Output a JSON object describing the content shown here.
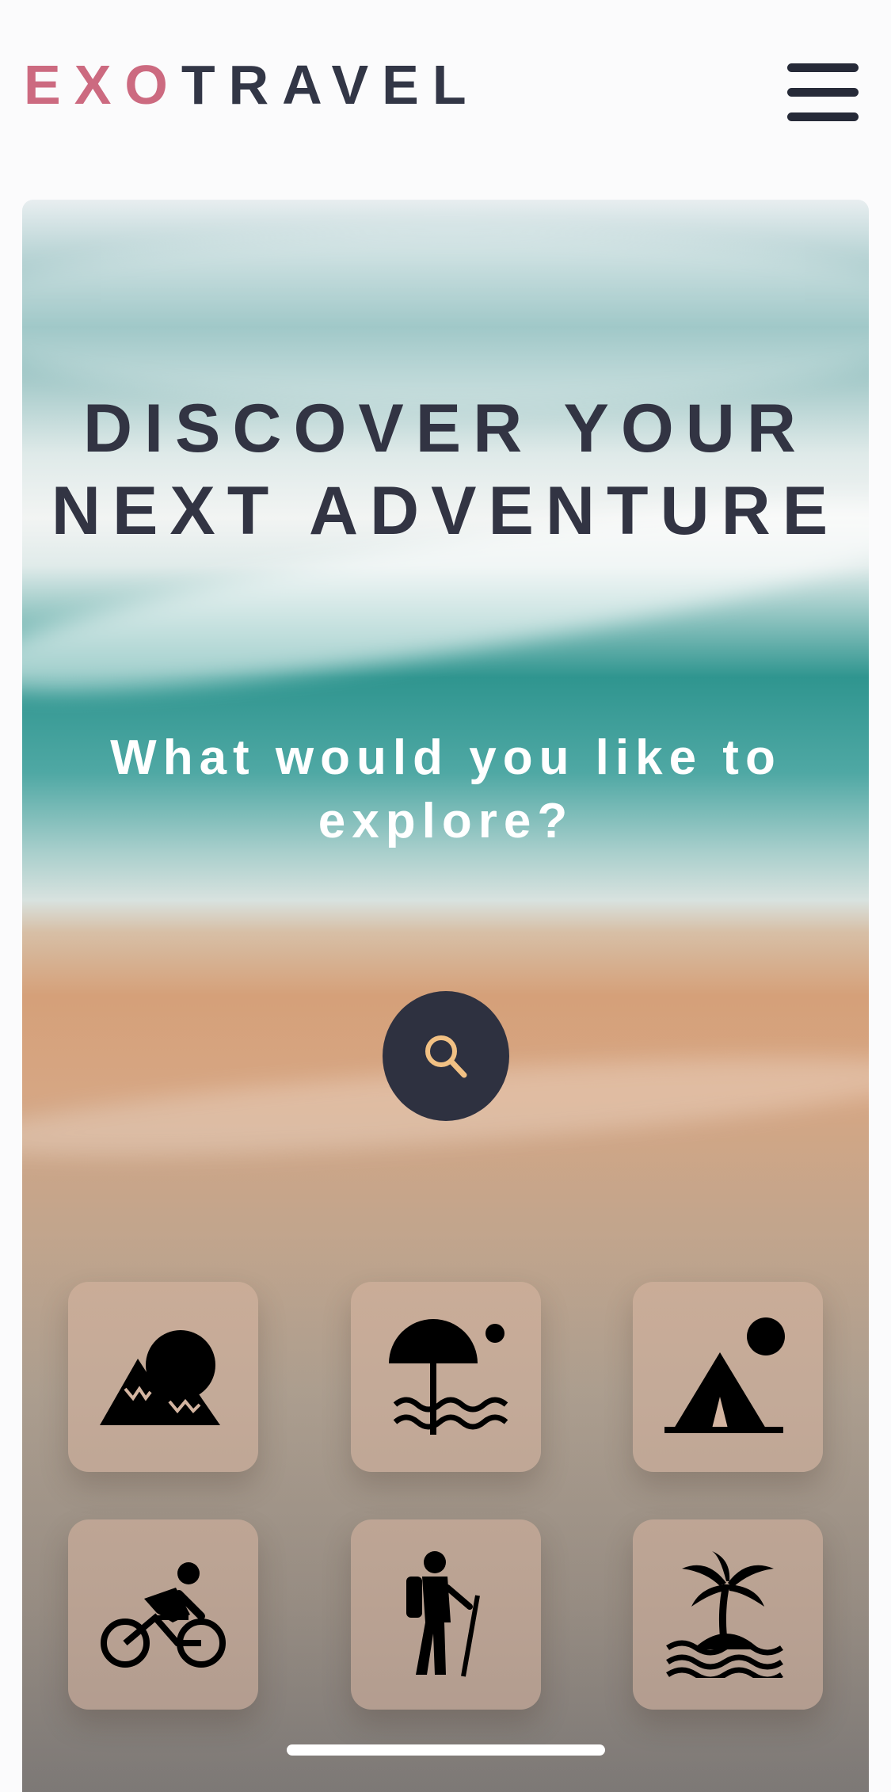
{
  "header": {
    "logo_part1": "EXO",
    "logo_part2": "TRAVEL",
    "menu_icon": "hamburger-icon"
  },
  "hero": {
    "title_line1": "DISCOVER YOUR",
    "title_line2": "NEXT ADVENTURE",
    "subtitle_line1": "What would you like to",
    "subtitle_line2": "explore?",
    "search_icon": "search-icon"
  },
  "categories": [
    {
      "icon": "mountain-icon"
    },
    {
      "icon": "beach-umbrella-icon"
    },
    {
      "icon": "camping-tent-icon"
    },
    {
      "icon": "cycling-icon"
    },
    {
      "icon": "hiking-icon"
    },
    {
      "icon": "island-icon"
    }
  ],
  "colors": {
    "brand_accent": "#cc6a80",
    "brand_dark": "#323646",
    "search_icon": "#f2c184"
  }
}
